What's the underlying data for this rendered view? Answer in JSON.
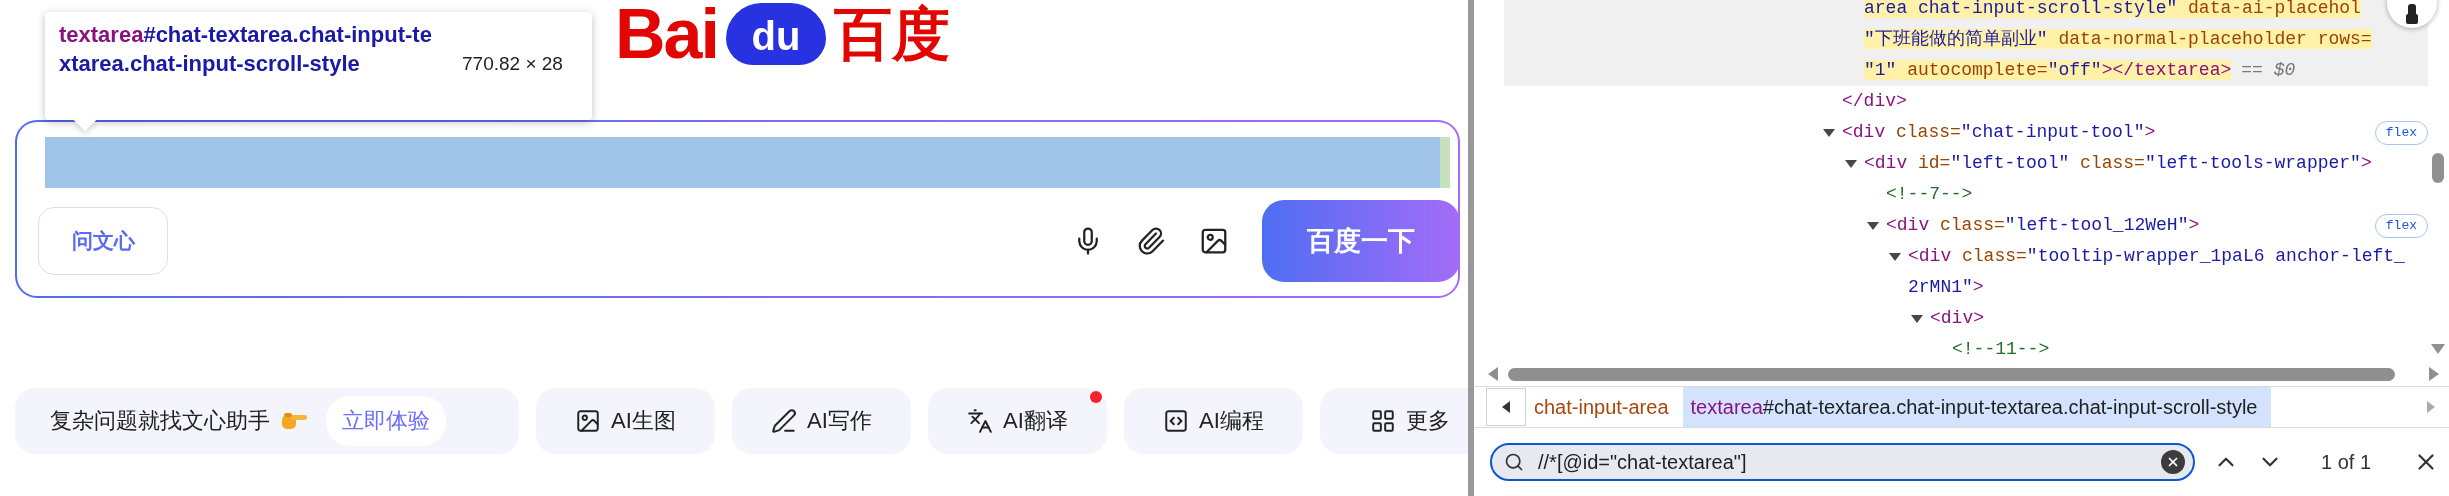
{
  "page": {
    "logo": {
      "latin": "Bai",
      "paw": "du",
      "chinese": "百度"
    },
    "inspect_tooltip": {
      "tag": "textarea",
      "selector": "#chat-textarea.chat-input-textarea.chat-input-scroll-style",
      "size": "770.82 × 28"
    },
    "input_box": {
      "textarea_highlighted": true,
      "wenxin_button": "问文心",
      "search_button": "百度一下"
    },
    "chips": [
      {
        "kind": "promo",
        "label": "复杂问题就找文心助手",
        "action": "立即体验"
      },
      {
        "kind": "tool",
        "label": "AI生图",
        "notification": false
      },
      {
        "kind": "tool",
        "label": "AI写作",
        "notification": false
      },
      {
        "kind": "tool",
        "label": "AI翻译",
        "notification": true
      },
      {
        "kind": "tool",
        "label": "AI编程",
        "notification": false
      },
      {
        "kind": "tool",
        "label": "更多"
      }
    ]
  },
  "devtools": {
    "elements_tree": [
      {
        "selected": false,
        "matched": false,
        "children": [
          {
            "selected": true,
            "matched": true,
            "marker": "== $0",
            "lines": [
              [
                {
                  "kind": "value",
                  "text": "area chat-input-scroll-style\""
                },
                {
                  "kind": "attr",
                  "text": " data-ai-placehol"
                }
              ],
              [
                {
                  "kind": "value",
                  "text": "\"下班能做的简单副业\""
                },
                {
                  "kind": "attr",
                  "text": " data-normal-placeholder rows="
                }
              ],
              [
                {
                  "kind": "value",
                  "text": "\"1\""
                },
                {
                  "kind": "attr",
                  "text": " autocomplete="
                },
                {
                  "kind": "value",
                  "text": "\"off\""
                },
                {
                  "kind": "tag",
                  "text": "></textarea>"
                }
              ]
            ]
          }
        ],
        "close": [
          {
            "kind": "tag",
            "text": "</div>"
          }
        ]
      },
      {
        "selected": false,
        "matched": false,
        "expanded": true,
        "badge": "flex",
        "lines": [
          [
            {
              "kind": "tag",
              "text": "<div"
            },
            {
              "kind": "attr",
              "text": " class="
            },
            {
              "kind": "value",
              "text": "\"chat-input-tool\""
            },
            {
              "kind": "tag",
              "text": ">"
            }
          ]
        ],
        "children": [
          {
            "selected": false,
            "matched": false,
            "expanded": true,
            "lines": [
              [
                {
                  "kind": "tag",
                  "text": "<div"
                },
                {
                  "kind": "attr",
                  "text": " id="
                },
                {
                  "kind": "value",
                  "text": "\"left-tool\""
                },
                {
                  "kind": "attr",
                  "text": " class="
                },
                {
                  "kind": "value",
                  "text": "\"left-tools-wrapper\""
                },
                {
                  "kind": "tag",
                  "text": ">"
                }
              ]
            ],
            "children": [
              {
                "selected": false,
                "matched": false,
                "lines": [
                  [
                    {
                      "kind": "comment",
                      "text": "<!--7-->"
                    }
                  ]
                ]
              },
              {
                "selected": false,
                "matched": false,
                "expanded": true,
                "badge": "flex",
                "lines": [
                  [
                    {
                      "kind": "tag",
                      "text": "<div"
                    },
                    {
                      "kind": "attr",
                      "text": " class="
                    },
                    {
                      "kind": "value",
                      "text": "\"left-tool_12WeH\""
                    },
                    {
                      "kind": "tag",
                      "text": ">"
                    }
                  ]
                ],
                "children": [
                  {
                    "selected": false,
                    "matched": false,
                    "expanded": true,
                    "lines": [
                      [
                        {
                          "kind": "tag",
                          "text": "<div"
                        },
                        {
                          "kind": "attr",
                          "text": " class="
                        },
                        {
                          "kind": "value",
                          "text": "\"tooltip-wrapper_1paL6 anchor-left_"
                        }
                      ],
                      [
                        {
                          "kind": "value",
                          "text": "2rMN1\""
                        },
                        {
                          "kind": "tag",
                          "text": ">"
                        }
                      ]
                    ],
                    "children": [
                      {
                        "selected": false,
                        "matched": false,
                        "expanded": true,
                        "lines": [
                          [
                            {
                              "kind": "tag",
                              "text": "<div>"
                            }
                          ]
                        ],
                        "children": [
                          {
                            "selected": false,
                            "matched": false,
                            "lines": [
                              [
                                {
                                  "kind": "comment",
                                  "text": "<!--11-->"
                                }
                              ]
                            ]
                          }
                        ]
                      }
                    ]
                  }
                ]
              }
            ]
          }
        ]
      }
    ],
    "breadcrumbs": [
      {
        "kind": "class",
        "selector": "chat-input-area",
        "selected": false
      },
      {
        "kind": "element",
        "tag": "textarea",
        "selector": "#chat-textarea.chat-input-textarea.chat-input-scroll-style",
        "selected": true
      }
    ],
    "search": {
      "value": "//*[@id=\"chat-textarea\"]",
      "match_count": "1 of 1"
    }
  }
}
